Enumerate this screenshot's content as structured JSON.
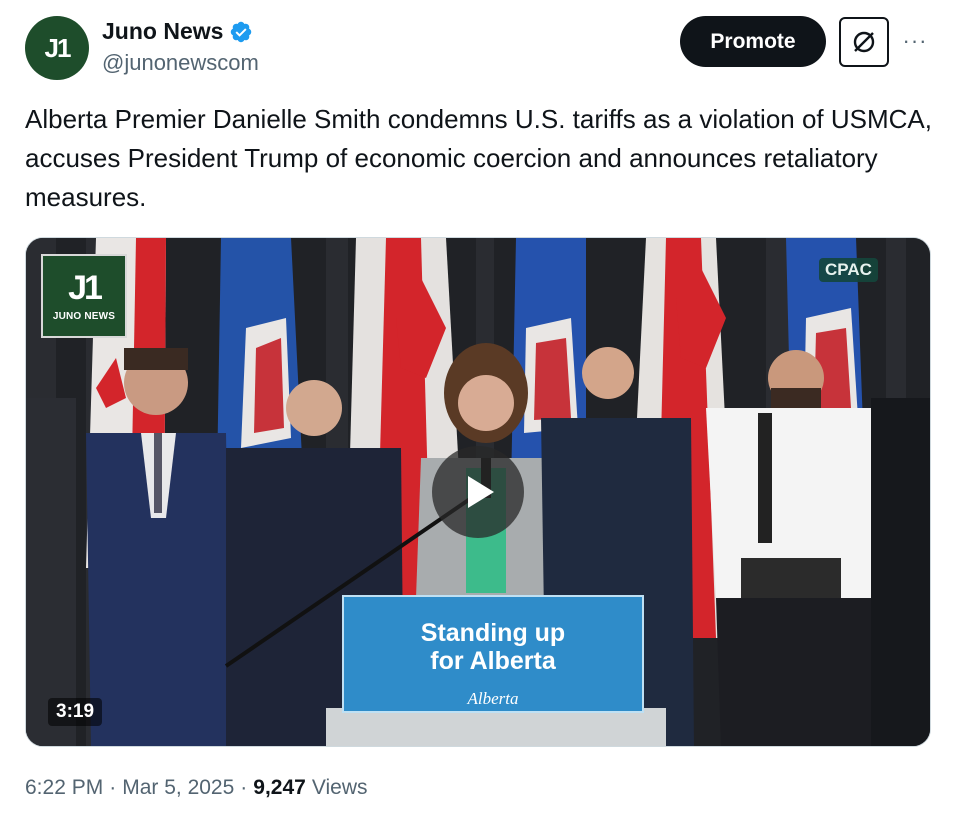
{
  "author": {
    "display_name": "Juno News",
    "handle": "@junonewscom",
    "avatar_text": "J1",
    "verified": true
  },
  "actions": {
    "promote_label": "Promote",
    "more_label": "···"
  },
  "tweet": {
    "text": "Alberta Premier Danielle Smith condemns U.S. tariffs as a violation of USMCA, accuses President Trump of economic coercion and announces retaliatory measures."
  },
  "video": {
    "logo_mark": "J1",
    "logo_word": "JUNO NEWS",
    "source_badge": "CPAC",
    "sign_line1": "Standing up",
    "sign_line2": "for Alberta",
    "sign_brand": "Alberta",
    "duration": "3:19"
  },
  "meta": {
    "time": "6:22 PM",
    "date": "Mar 5, 2025",
    "views_count": "9,247",
    "views_label": "Views",
    "separator": "·"
  },
  "colors": {
    "brand_green": "#1e4d2b",
    "verified_blue": "#1d9bf0",
    "text_primary": "#0f1419",
    "text_secondary": "#536471"
  }
}
